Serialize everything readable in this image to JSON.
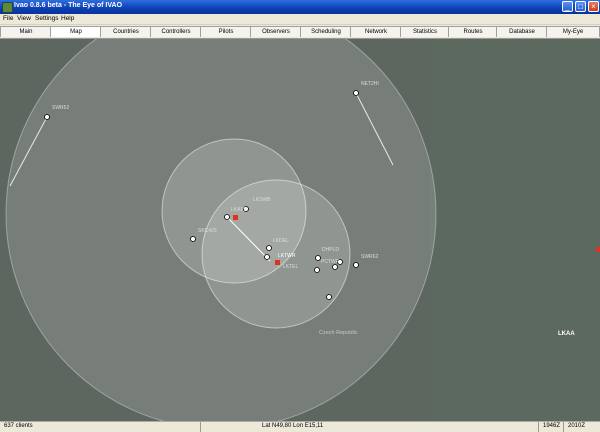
{
  "window": {
    "title": "Ivao 0.8.6 beta - The Eye of IVAO",
    "min": "_",
    "max": "□",
    "close": "×"
  },
  "menu": [
    "File",
    "View",
    "Settings",
    "Help"
  ],
  "tabs": [
    "Main",
    "Map",
    "Countries",
    "Controllers",
    "Pilots",
    "Observers",
    "Scheduling",
    "Network",
    "Statistics",
    "Routes",
    "Database",
    "My-Eye"
  ],
  "active_tab": "Map",
  "map": {
    "region_label": "Czech Republic",
    "fir_label": "LKAA",
    "callsigns": {
      "swr": "SWR52",
      "nt": "NET2HI",
      "lkrwp": "LKSWB",
      "lktwr": "LKTWR",
      "skc": "SKC426",
      "lkapp": "LKAPP",
      "lkdel": "LKDEL",
      "lktel": "LKTEL",
      "dhpld": "DHPLD",
      "pctw": "PCTWR",
      "swr2": "SWR62"
    },
    "colors": {
      "ground": "#5e6660",
      "coverage": "#ffffff",
      "aircraft": "#ffffff",
      "controller": "#e03020"
    }
  },
  "status": {
    "clients": "637 clients",
    "position": "Lat N49,80 Lon E15,11",
    "local_time": "1946Z",
    "utc_time": "2010Z"
  }
}
